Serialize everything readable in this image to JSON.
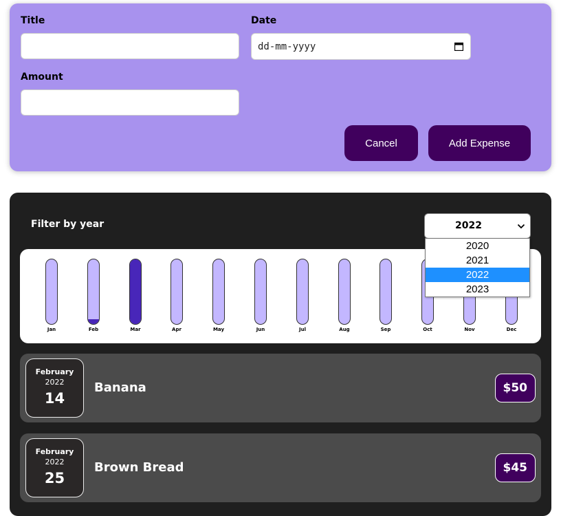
{
  "form": {
    "title_label": "Title",
    "title_value": "",
    "date_label": "Date",
    "date_placeholder": "dd-mm-yyyy",
    "amount_label": "Amount",
    "amount_value": "",
    "cancel_label": "Cancel",
    "add_label": "Add Expense"
  },
  "filter": {
    "label": "Filter by year",
    "selected": "2022",
    "options": [
      "2020",
      "2021",
      "2022",
      "2023"
    ]
  },
  "chart_data": {
    "type": "bar",
    "categories": [
      "Jan",
      "Feb",
      "Mar",
      "Apr",
      "May",
      "Jun",
      "Jul",
      "Aug",
      "Sep",
      "Oct",
      "Nov",
      "Dec"
    ],
    "values": [
      0,
      0.07,
      1,
      0,
      0,
      0,
      0,
      0,
      0,
      0,
      0,
      0
    ],
    "value_scale": "fraction of largest month",
    "colors": {
      "track": "#c3b7ff",
      "fill": "#4826b9"
    }
  },
  "expenses": [
    {
      "month": "February",
      "year": "2022",
      "day": "14",
      "title": "Banana",
      "amount": "$50"
    },
    {
      "month": "February",
      "year": "2022",
      "day": "25",
      "title": "Brown Bread",
      "amount": "$45"
    }
  ],
  "colors": {
    "form_bg": "#a892ee",
    "button_bg": "#40005d",
    "panel_bg": "#1f1f1f",
    "item_bg": "#4b4b4b",
    "select_highlight": "#1e90ff"
  }
}
